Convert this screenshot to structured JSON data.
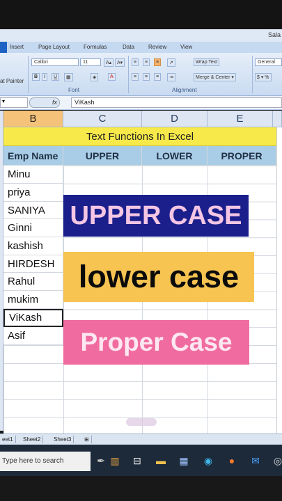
{
  "window": {
    "title": "Sala"
  },
  "ribbon": {
    "tabs": [
      "Insert",
      "Page Layout",
      "Formulas",
      "Data",
      "Review",
      "View"
    ],
    "font_name": "Calibri",
    "font_size": "11",
    "wrap_text": "Wrap Text",
    "merge_center": "Merge & Center",
    "number_format": "General",
    "format_painter": "at Painter",
    "groups": {
      "font": "Font",
      "alignment": "Alignment"
    }
  },
  "formula_bar": {
    "fx": "fx",
    "value": "ViKash"
  },
  "columns": [
    "B",
    "C",
    "D",
    "E"
  ],
  "sheet": {
    "title": "Text Functions In Excel",
    "headers": [
      "Emp Name",
      "UPPER",
      "LOWER",
      "PROPER"
    ],
    "names": [
      "Minu",
      "priya",
      "SANIYA",
      "Ginni",
      "kashish",
      "HIRDESH",
      "Rahul",
      "mukim",
      "ViKash",
      "Asif"
    ]
  },
  "overlays": {
    "upper": "UPPER CASE",
    "lower": "lower case",
    "proper": "Proper Case"
  },
  "sheet_tabs": [
    "eet1",
    "Sheet2",
    "Sheet3"
  ],
  "taskbar": {
    "search_placeholder": "Type here to search"
  },
  "colors": {
    "title_row": "#f7e94a",
    "header_row": "#a9cde6",
    "upper_bg": "#1a1f8c",
    "lower_bg": "#f7c451",
    "proper_bg": "#f06ca0"
  }
}
